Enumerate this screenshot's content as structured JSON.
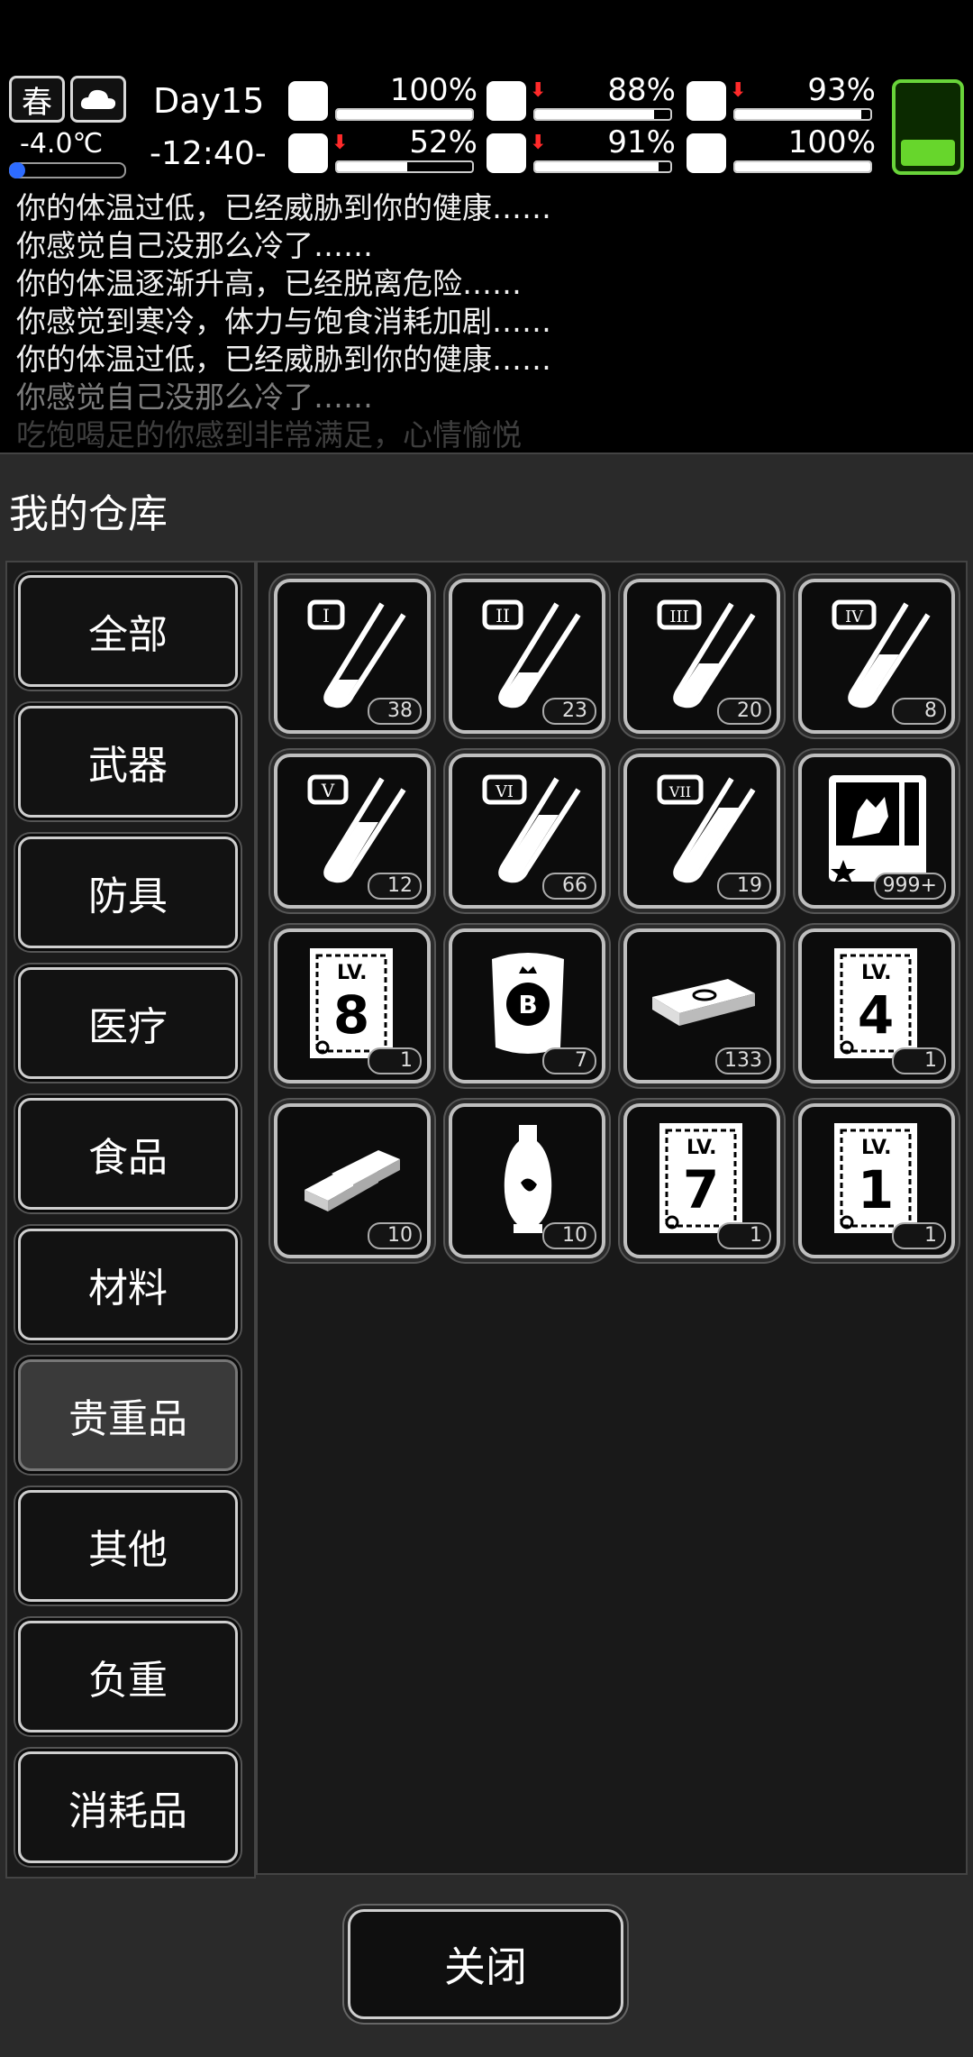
{
  "status": {
    "season": "春",
    "weather_icon": "cloud-icon",
    "temperature": "-4.0℃",
    "day": "Day15",
    "time": "-12:40-",
    "stats": [
      {
        "key": "health",
        "icon": "medkit-icon",
        "value": "100%",
        "level": 1.0,
        "down": false
      },
      {
        "key": "hunger",
        "icon": "stomach-icon",
        "value": "88%",
        "level": 0.88,
        "down": true
      },
      {
        "key": "stamina",
        "icon": "capsule-icon",
        "value": "93%",
        "level": 0.93,
        "down": true
      },
      {
        "key": "fatigue",
        "icon": "leg-icon",
        "value": "52%",
        "level": 0.52,
        "down": true
      },
      {
        "key": "thirst",
        "icon": "water-drop-icon",
        "value": "91%",
        "level": 0.91,
        "down": true
      },
      {
        "key": "mood",
        "icon": "heart-icon",
        "value": "100%",
        "level": 1.0,
        "down": false
      }
    ],
    "battery_level": 0.3,
    "battery_color": "#67d62c"
  },
  "log": [
    "你的体温过低，已经威胁到你的健康……",
    "你感觉自己没那么冷了……",
    "你的体温逐渐升高，已经脱离危险……",
    "你感觉到寒冷，体力与饱食消耗加剧……",
    "你的体温过低，已经威胁到你的健康……",
    "你感觉自己没那么冷了……",
    "吃饱喝足的你感到非常满足，心情愉悦"
  ],
  "warehouse": {
    "title": "我的仓库",
    "categories": [
      "全部",
      "武器",
      "防具",
      "医疗",
      "食品",
      "材料",
      "贵重品",
      "其他",
      "负重",
      "消耗品"
    ],
    "active_category": "贵重品",
    "items": [
      {
        "icon": "test-tube-I-icon",
        "label": "I",
        "count": "38"
      },
      {
        "icon": "test-tube-II-icon",
        "label": "II",
        "count": "23"
      },
      {
        "icon": "test-tube-III-icon",
        "label": "III",
        "count": "20"
      },
      {
        "icon": "test-tube-IV-icon",
        "label": "IV",
        "count": "8"
      },
      {
        "icon": "test-tube-V-icon",
        "label": "V",
        "count": "12"
      },
      {
        "icon": "test-tube-VI-icon",
        "label": "VI",
        "count": "66"
      },
      {
        "icon": "test-tube-VII-icon",
        "label": "VII",
        "count": "19"
      },
      {
        "icon": "monster-card-icon",
        "label": "",
        "count": "999+"
      },
      {
        "icon": "level-book-8-icon",
        "label": "8",
        "count": "1"
      },
      {
        "icon": "bitcoin-bag-icon",
        "label": "B",
        "count": "7"
      },
      {
        "icon": "cash-stack-icon",
        "label": "",
        "count": "133"
      },
      {
        "icon": "level-book-4-icon",
        "label": "4",
        "count": "1"
      },
      {
        "icon": "gold-bars-icon",
        "label": "",
        "count": "10"
      },
      {
        "icon": "vase-icon",
        "label": "",
        "count": "10"
      },
      {
        "icon": "level-book-7-icon",
        "label": "7",
        "count": "1"
      },
      {
        "icon": "level-book-1-icon",
        "label": "1",
        "count": "1"
      }
    ],
    "close_label": "关闭"
  }
}
